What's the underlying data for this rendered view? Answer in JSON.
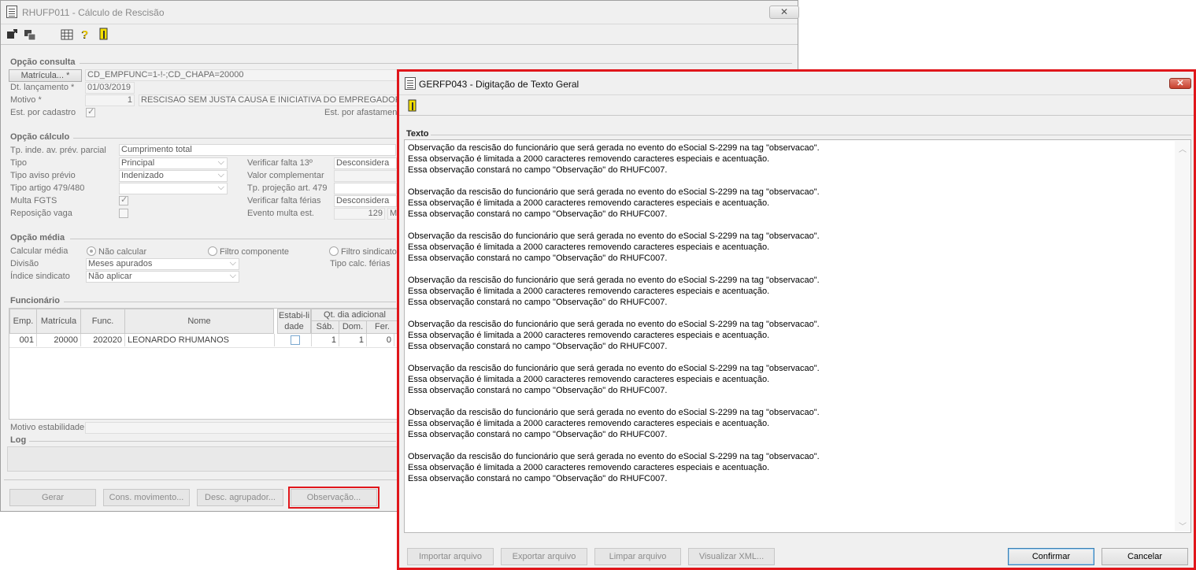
{
  "back_window": {
    "title": "RHUFP011 - Cálculo de Rescisão",
    "close_label": "✕",
    "consulta": {
      "group_title": "Opção consulta",
      "matricula_button": "Matrícula... *",
      "matricula_value": "CD_EMPFUNC=1-!-;CD_CHAPA=20000",
      "dt_lancamento_label": "Dt. lançamento *",
      "dt_lancamento_value": "01/03/2019",
      "motivo_label": "Motivo *",
      "motivo_code": "1",
      "motivo_desc": "RESCISAO SEM JUSTA CAUSA E INICIATIVA DO EMPREGADOR",
      "est_cadastro_label": "Est. por cadastro",
      "est_afastamento_label": "Est. por afastament"
    },
    "calculo": {
      "group_title": "Opção cálculo",
      "tp_inde_label": "Tp. inde. av. prév. parcial",
      "tp_inde_value": "Cumprimento total",
      "tipo_label": "Tipo",
      "tipo_value": "Principal",
      "tipo_aviso_label": "Tipo aviso prévio",
      "tipo_aviso_value": "Indenizado",
      "tipo_artigo_label": "Tipo artigo 479/480",
      "tipo_artigo_value": "",
      "multa_fgts_label": "Multa FGTS",
      "reposicao_label": "Reposição vaga",
      "verificar_13_label": "Verificar falta 13º",
      "verificar_13_value": "Desconsidera",
      "valor_comp_label": "Valor complementar",
      "tp_projecao_label": "Tp. projeção art. 479",
      "verificar_ferias_label": "Verificar falta férias",
      "verificar_ferias_value": "Desconsidera",
      "evento_multa_label": "Evento multa est.",
      "evento_multa_value": "129",
      "evento_multa_extra": "M"
    },
    "media": {
      "group_title": "Opção média",
      "calcular_label": "Calcular média",
      "nao_calcular": "Não calcular",
      "filtro_componente": "Filtro componente",
      "filtro_sindicato": "Filtro sindicato",
      "divisao_label": "Divisão",
      "divisao_value": "Meses apurados",
      "indice_label": "Índice sindicato",
      "indice_value": "Não aplicar",
      "tipo_calc_ferias_label": "Tipo calc. férias"
    },
    "funcionario": {
      "group_title": "Funcionário",
      "headers": {
        "emp": "Emp.",
        "matricula": "Matrícula",
        "func": "Func.",
        "nome": "Nome",
        "estab": "Estabi-lidade",
        "qt_dia": "Qt. dia adicional",
        "sab": "Sáb.",
        "dom": "Dom.",
        "fer": "Fer."
      },
      "row": {
        "emp": "001",
        "matricula": "20000",
        "func": "202020",
        "nome": "LEONARDO RHUMANOS",
        "sab": "1",
        "dom": "1",
        "fer": "0"
      },
      "motivo_estab_label": "Motivo estabilidade"
    },
    "log_title": "Log",
    "buttons": {
      "gerar": "Gerar",
      "cons_movimento": "Cons. movimento...",
      "desc_agrupador": "Desc. agrupador...",
      "observacao": "Observação..."
    }
  },
  "front_window": {
    "title": "GERFP043 - Digitação de Texto Geral",
    "close_label": "✕",
    "texto_title": "Texto",
    "paragraph_lines": [
      "Observação da rescisão do funcionário que será gerada no evento do eSocial S-2299 na tag \"observacao\".",
      "Essa observação é limitada a 2000 caracteres removendo caracteres especiais e acentuação.",
      "Essa observação constará no campo \"Observação\" do RHUFC007."
    ],
    "buttons": {
      "importar": "Importar arquivo",
      "exportar": "Exportar arquivo",
      "limpar": "Limpar arquivo",
      "visualizar": "Visualizar XML...",
      "confirmar": "Confirmar",
      "cancelar": "Cancelar"
    }
  }
}
